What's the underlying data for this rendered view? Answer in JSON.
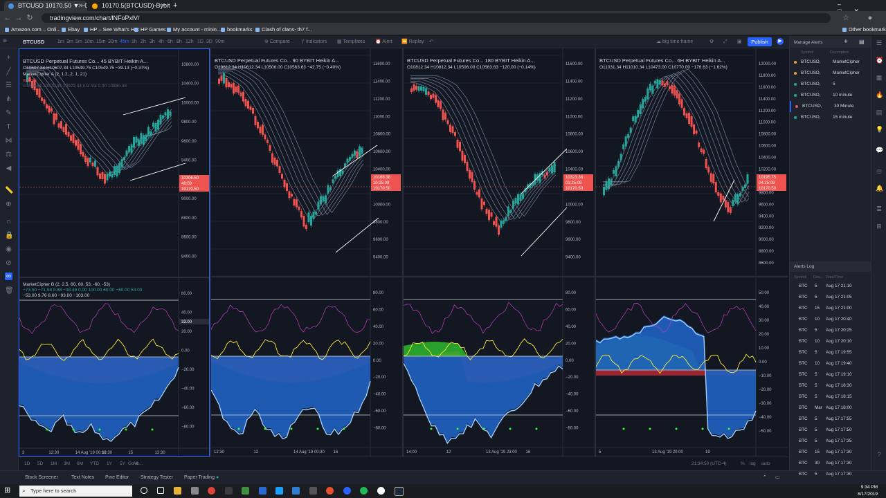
{
  "browser": {
    "tabs": [
      {
        "title": "BTCUSD 10170.50 ▼ −0.25% bi..."
      },
      {
        "title": "10170.5(BTCUSD)-Bybit"
      }
    ],
    "url": "tradingview.com/chart/lNFoPxlV/",
    "bookmarks": [
      "Amazon.com – Onli...",
      "Ebay",
      "HP – See What's Hot",
      "HP Games",
      "My account - minin...",
      "bookmarks",
      "Clash of clans- th7 f...",
      "Other bookmarks"
    ]
  },
  "toolbar": {
    "symbol": "BTCUSD",
    "intervals": [
      "1m",
      "3m",
      "5m",
      "10m",
      "15m",
      "30m",
      "45m",
      "1h",
      "2h",
      "3h",
      "4h",
      "6h",
      "8h",
      "12h",
      "1D",
      "3D",
      "90m"
    ],
    "compare": "Compare",
    "indicators": "Indicators",
    "templates": "Templates",
    "alert": "Alert",
    "replay": "Replay",
    "layout_name": "big time frame",
    "publish": "Publish"
  },
  "panes": [
    {
      "title": "BTCUSD Perpetual Futures Co...  45  BYBIT  Heikin A...",
      "ohlc": "O10607.34  H10607.34  L10549.75  C10549.75  −39.13 (−0.37%)",
      "indicator_a": "MarketCipher A (2, 1.2, 2, 1, 21)",
      "indicator_a_vals": "n/a  n/a",
      "indicator_a_vals2": "10896.64  10929.44  10929.44  n/a  n/a  0.00  10880.38",
      "price_axis": [
        "10800.00",
        "10400.00",
        "10000.00",
        "9800.00",
        "9600.00",
        "9400.00",
        "9200.00",
        "9000.00",
        "8800.00",
        "8600.00",
        "8400.00"
      ],
      "price_tags": [
        "10306.50",
        "48:09",
        "10170.50"
      ],
      "indicator_b": "MarketCipher B (2, 2.5, 60, 60, 53, -60, -53)",
      "indicator_b_vals": "−73.50  −71.58  0.88  −38.46  0.00  100.00  60.00  −60.00  53.00",
      "indicator_b_vals2": "−53.00  9.76  8.60  −93.00  −103.00",
      "osc_axis": [
        "60.00",
        "40.00",
        "20.00",
        "0.00",
        "−20.00",
        "−40.00",
        "−60.00",
        "−80.00"
      ],
      "osc_tag": "33.00",
      "time_axis": [
        "3",
        "12:30",
        "14 Aug '19  00:30",
        "12:30",
        "15",
        "12:30"
      ]
    },
    {
      "title": "BTCUSD Perpetual Futures Co...  90  BYBIT  Heikin A...",
      "ohlc": "O10612.34  H10612.34  L10506.00  C10563.63  −42.75 (−0.40%)",
      "price_axis": [
        "11600.00",
        "11400.00",
        "11200.00",
        "11000.00",
        "10800.00",
        "10600.00",
        "10400.00",
        "10200.00",
        "10000.00",
        "9800.00",
        "9600.00",
        "9400.00"
      ],
      "price_tags": [
        "10168.38",
        "10:25:09",
        "10170.50"
      ],
      "osc_axis": [
        "80.00",
        "60.00",
        "40.00",
        "20.00",
        "0.00",
        "−20.00",
        "−40.00",
        "−60.00",
        "−80.00"
      ],
      "time_axis": [
        "12:30",
        "12",
        "14 Aug '19  00:30",
        "16"
      ]
    },
    {
      "title": "BTCUSD Perpetual Futures Co...  180  BYBIT  Heikin A...",
      "ohlc": "O10812.34  H10812.34  L10506.00  C10563.63  −120.00 (−0.14%)",
      "price_axis": [
        "11600.00",
        "11400.00",
        "11200.00",
        "11000.00",
        "10800.00",
        "10600.00",
        "10400.00",
        "10200.00",
        "10000.00",
        "9800.00",
        "9600.00",
        "9400.00"
      ],
      "price_tags": [
        "10323.38",
        "01:25:09",
        "10170.50"
      ],
      "osc_axis": [
        "80.00",
        "60.00",
        "40.00",
        "20.00",
        "0.00",
        "−20.00",
        "−40.00",
        "−60.00",
        "−80.00"
      ],
      "time_axis": [
        "14:00",
        "12",
        "13 Aug '19  23:00",
        "16"
      ]
    },
    {
      "title": "BTCUSD Perpetual Futures Co...  6H  BYBIT  Heikin A...",
      "ohlc": "O11031.34  H11010.34  L10473.00  C10770.00  −176.63 (−1.62%)",
      "price_axis": [
        "12000.00",
        "11800.00",
        "11600.00",
        "11400.00",
        "11200.00",
        "11000.00",
        "10800.00",
        "10600.00",
        "10400.00",
        "10200.00",
        "10000.00",
        "9800.00",
        "9600.00",
        "9400.00",
        "9200.00",
        "9000.00",
        "8800.00",
        "8600.00"
      ],
      "price_tags": [
        "10195.75",
        "04:25:09",
        "10170.50"
      ],
      "osc_axis": [
        "50.00",
        "40.00",
        "30.00",
        "20.00",
        "10.00",
        "0.00",
        "−10.00",
        "−20.00",
        "−30.00",
        "−40.00",
        "−50.00"
      ],
      "time_axis": [
        "5",
        "13 Aug '19  20:00",
        "19"
      ]
    }
  ],
  "bottom_bar": {
    "ranges": [
      "1D",
      "5D",
      "1M",
      "3M",
      "6M",
      "YTD",
      "1Y",
      "5Y",
      "All"
    ],
    "goto": "Go to...",
    "clock": "21:34:50 (UTC-4)",
    "percent": "%",
    "log": "log",
    "auto": "auto"
  },
  "footer_tabs": [
    "Stock Screener",
    "Text Notes",
    "Pine Editor",
    "Strategy Tester",
    "Paper Trading"
  ],
  "alerts": {
    "title": "Manage Alerts",
    "col_symbol": "Symbol",
    "col_desc": "Description",
    "items": [
      {
        "symbol": "BTCUSD,",
        "desc": "MarketCipher",
        "color": "#f0a030"
      },
      {
        "symbol": "BTCUSD,",
        "desc": "MarketCipher",
        "color": "#f0a030"
      },
      {
        "symbol": "BTCUSD,",
        "desc": "5",
        "color": "#26a69a"
      },
      {
        "symbol": "BTCUSD,",
        "desc": "10 minute",
        "color": "#26a69a"
      },
      {
        "symbol": "BTCUSD,",
        "desc": "30 Minute",
        "color": "#ef5350"
      },
      {
        "symbol": "BTCUSD,",
        "desc": "15 minute",
        "color": "#26a69a"
      }
    ]
  },
  "alerts_log": {
    "title": "Alerts Log",
    "col_symbol": "Symbol",
    "col_desc": "Des...",
    "col_time": "Date/Time",
    "rows": [
      {
        "sym": "BTC",
        "d": "5",
        "t": "Aug 17 21:10"
      },
      {
        "sym": "BTC",
        "d": "5",
        "t": "Aug 17 21:05"
      },
      {
        "sym": "BTC",
        "d": "15",
        "t": "Aug 17 21:00"
      },
      {
        "sym": "BTC",
        "d": "10",
        "t": "Aug 17 20:40"
      },
      {
        "sym": "BTC",
        "d": "5",
        "t": "Aug 17 20:25"
      },
      {
        "sym": "BTC",
        "d": "10",
        "t": "Aug 17 20:10"
      },
      {
        "sym": "BTC",
        "d": "5",
        "t": "Aug 17 19:55"
      },
      {
        "sym": "BTC",
        "d": "10",
        "t": "Aug 17 19:40"
      },
      {
        "sym": "BTC",
        "d": "5",
        "t": "Aug 17 19:10"
      },
      {
        "sym": "BTC",
        "d": "5",
        "t": "Aug 17 18:30"
      },
      {
        "sym": "BTC",
        "d": "5",
        "t": "Aug 17 18:15"
      },
      {
        "sym": "BTC",
        "d": "Mar",
        "t": "Aug 17 18:00"
      },
      {
        "sym": "BTC",
        "d": "5",
        "t": "Aug 17 17:55"
      },
      {
        "sym": "BTC",
        "d": "5",
        "t": "Aug 17 17:50"
      },
      {
        "sym": "BTC",
        "d": "5",
        "t": "Aug 17 17:35"
      },
      {
        "sym": "BTC",
        "d": "15",
        "t": "Aug 17 17:30"
      },
      {
        "sym": "BTC",
        "d": "30",
        "t": "Aug 17 17:30"
      },
      {
        "sym": "BTC",
        "d": "5",
        "t": "Aug 17 17:30"
      }
    ]
  },
  "taskbar": {
    "search_placeholder": "Type here to search",
    "time": "9:34 PM",
    "date": "8/17/2019"
  }
}
